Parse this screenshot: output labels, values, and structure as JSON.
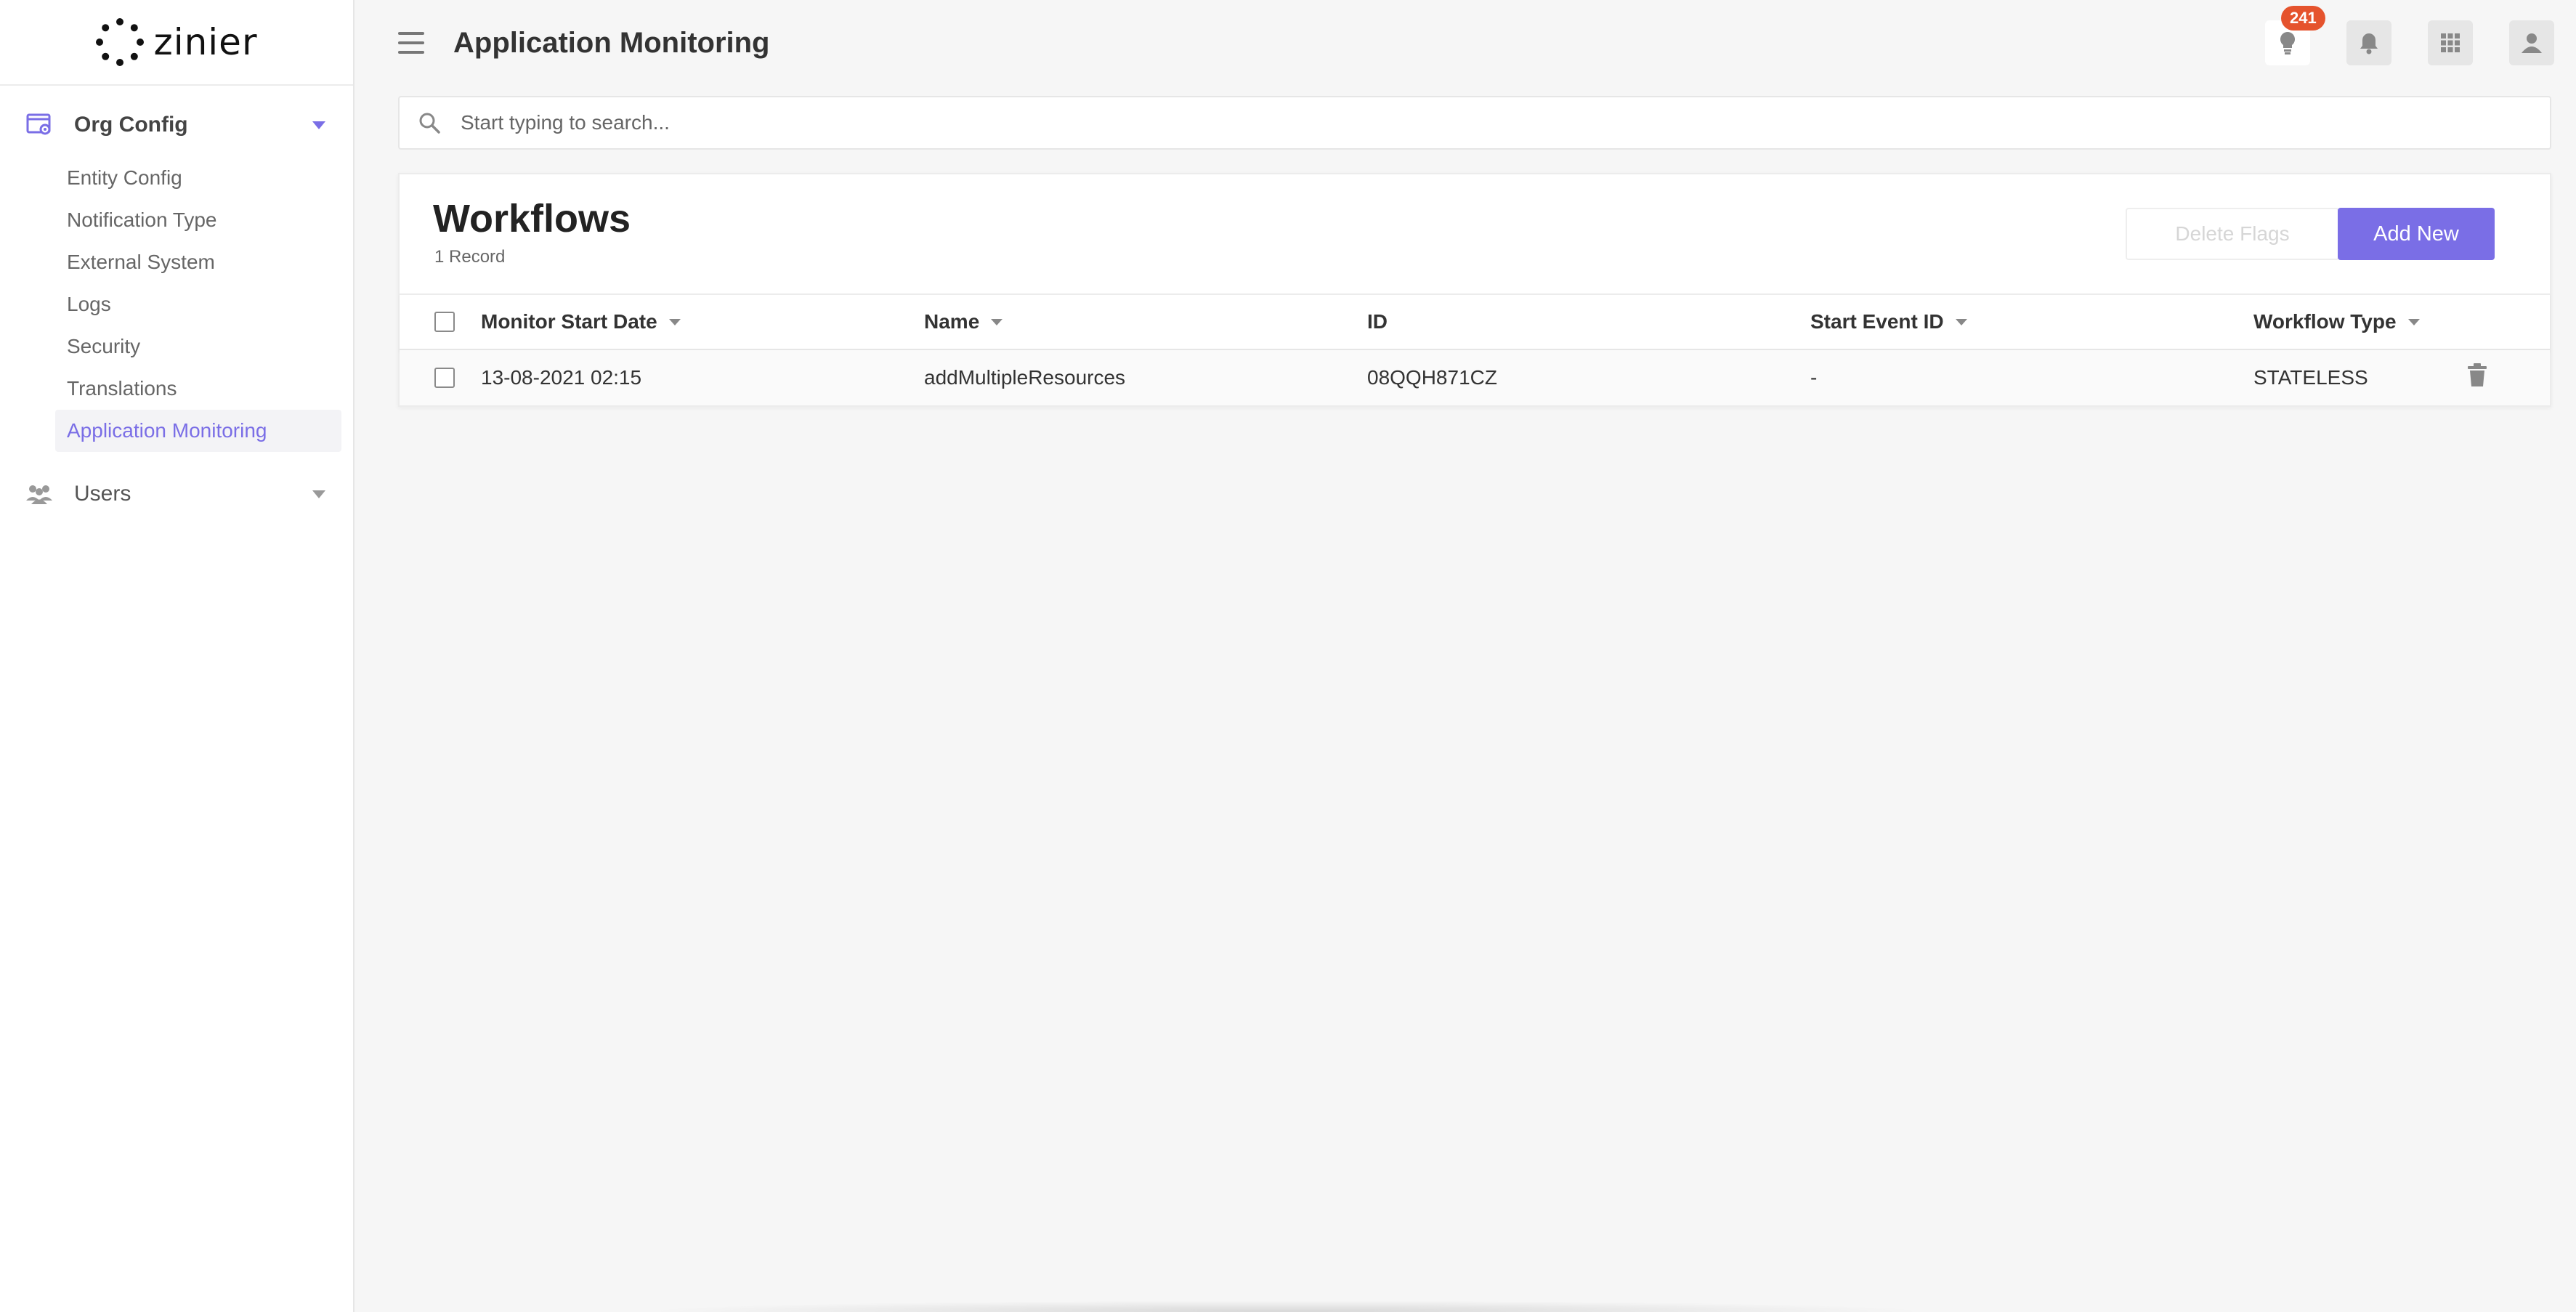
{
  "brand": {
    "logo_text": "zinier"
  },
  "sidebar": {
    "groups": [
      {
        "label": "Org Config",
        "icon": "org-config-icon",
        "expanded": true
      },
      {
        "label": "Users",
        "icon": "users-icon",
        "expanded": false
      }
    ],
    "items": [
      {
        "label": "Entity Config"
      },
      {
        "label": "Notification Type"
      },
      {
        "label": "External System"
      },
      {
        "label": "Logs"
      },
      {
        "label": "Security"
      },
      {
        "label": "Translations"
      },
      {
        "label": "Application Monitoring",
        "active": true
      }
    ]
  },
  "header": {
    "title": "Application Monitoring",
    "badge_count": "241",
    "icons": [
      "lightbulb-icon",
      "bell-icon",
      "apps-grid-icon",
      "user-icon"
    ]
  },
  "search": {
    "placeholder": "Start typing to search..."
  },
  "card": {
    "title": "Workflows",
    "record_count": "1 Record",
    "delete_label": "Delete Flags",
    "add_label": "Add New"
  },
  "table": {
    "columns": [
      "Monitor Start Date",
      "Name",
      "ID",
      "Start Event ID",
      "Workflow Type"
    ],
    "rows": [
      [
        "13-08-2021 02:15",
        "addMultipleResources",
        "08QQH871CZ",
        "-",
        "STATELESS"
      ]
    ]
  },
  "colors": {
    "accent": "#7a6ee6",
    "badge": "#e5532d",
    "background": "#f6f6f6"
  }
}
